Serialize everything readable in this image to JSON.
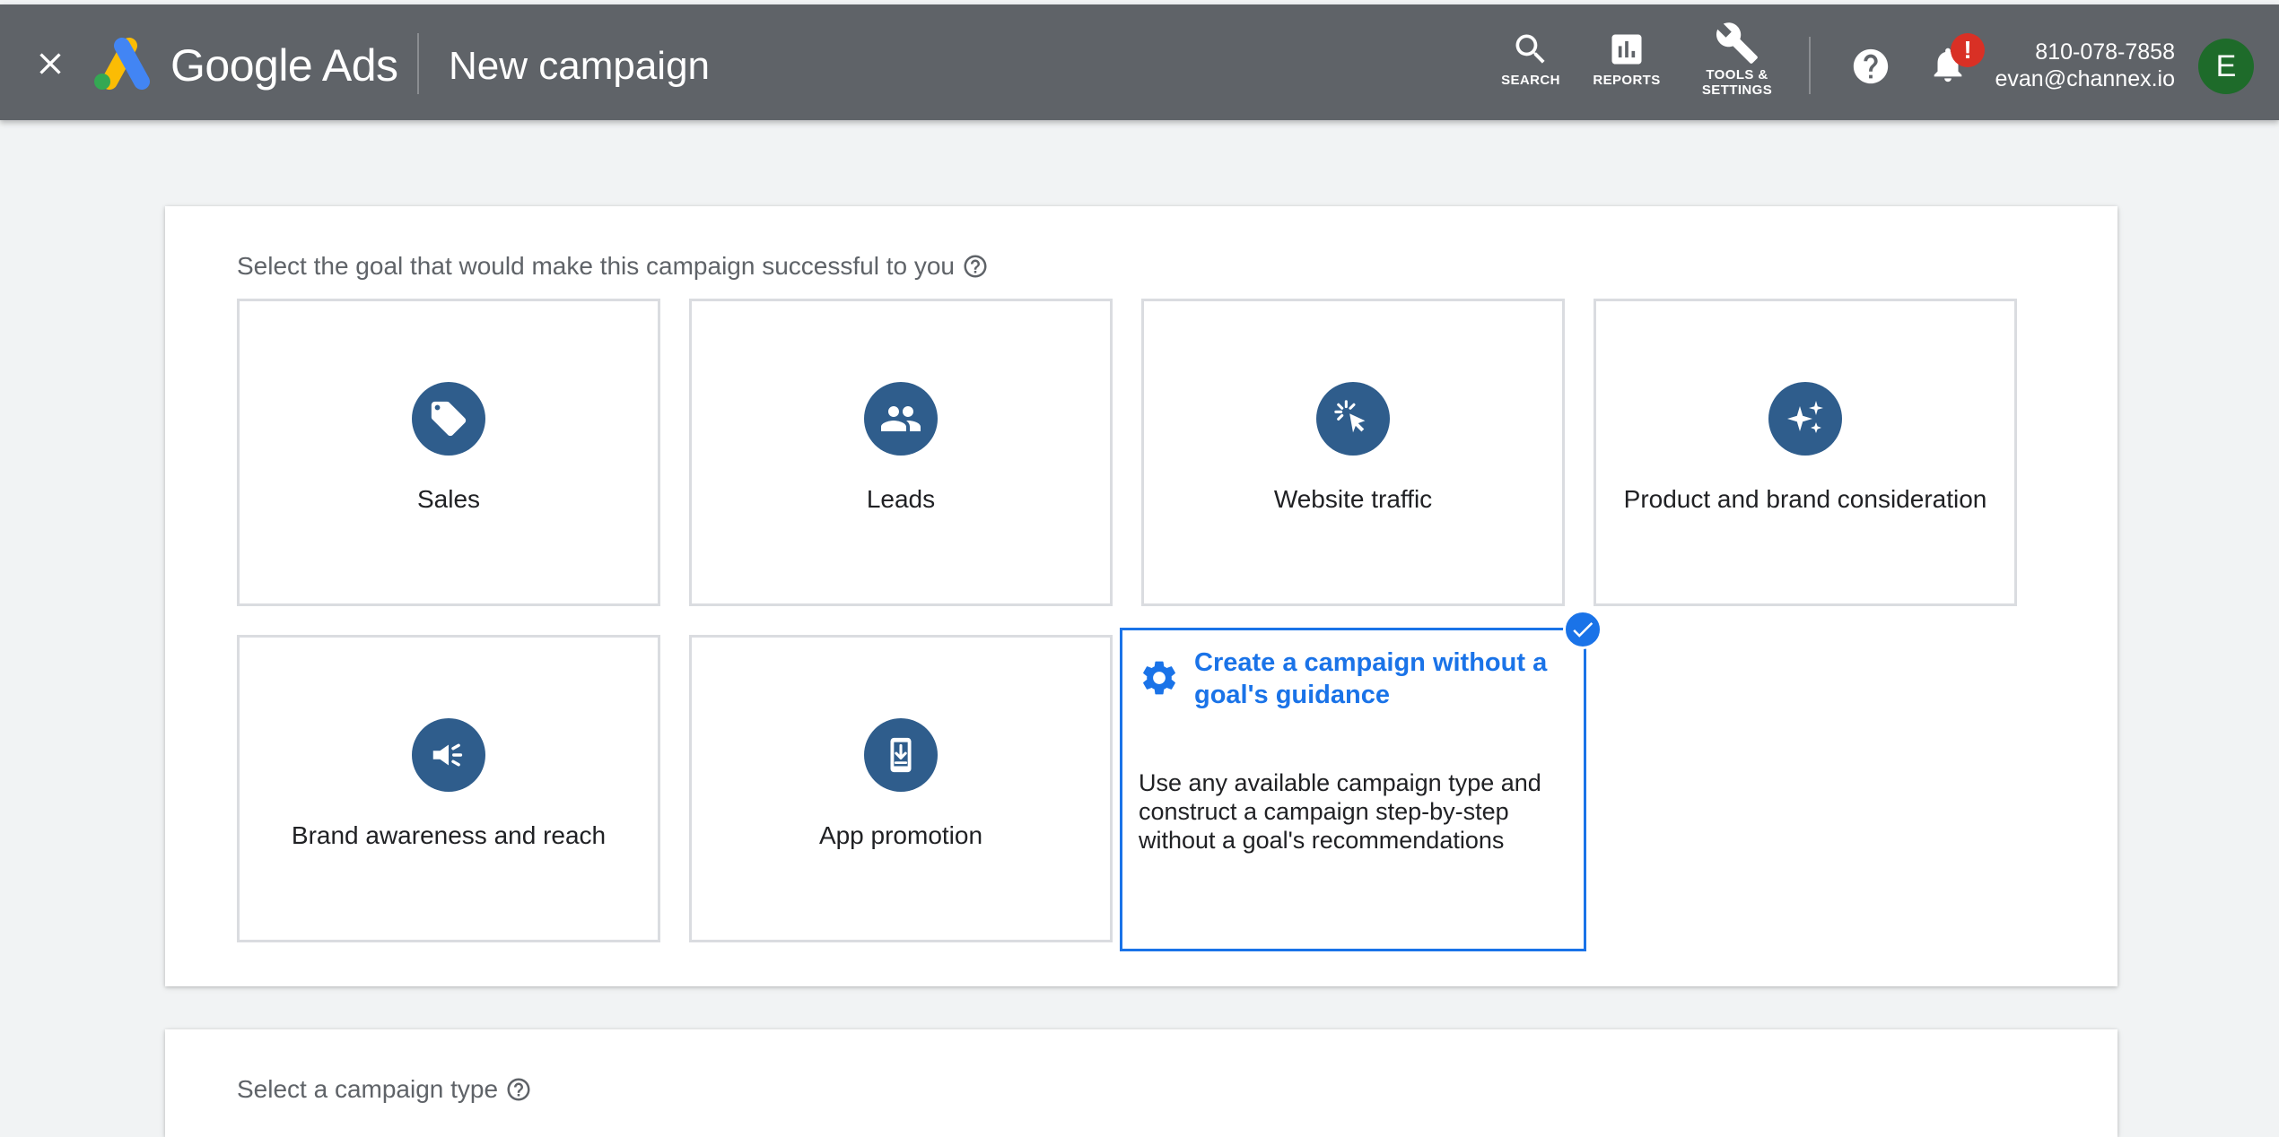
{
  "header": {
    "brand": "Google Ads",
    "title": "New campaign",
    "tools": [
      {
        "label": "SEARCH",
        "icon": "search-icon"
      },
      {
        "label": "REPORTS",
        "icon": "reports-icon"
      },
      {
        "label_line1": "TOOLS &",
        "label_line2": "SETTINGS",
        "icon": "wrench-icon"
      }
    ],
    "alert_badge": "!",
    "account": {
      "phone": "810-078-7858",
      "email": "evan@channex.io"
    },
    "avatar_initial": "E",
    "colors": {
      "bar": "#5f6368",
      "avatar": "#1e6b2a",
      "alert": "#d93025"
    }
  },
  "goal_section": {
    "heading": "Select the goal that would make this campaign successful to you",
    "goals": [
      {
        "label": "Sales",
        "icon": "tag-icon"
      },
      {
        "label": "Leads",
        "icon": "people-icon"
      },
      {
        "label": "Website traffic",
        "icon": "cursor-click-icon"
      },
      {
        "label": "Product and brand consideration",
        "icon": "sparkle-icon"
      },
      {
        "label": "Brand awareness and reach",
        "icon": "megaphone-icon"
      },
      {
        "label": "App promotion",
        "icon": "phone-download-icon"
      }
    ],
    "selected_goal": {
      "title": "Create a campaign without a goal's guidance",
      "description": "Use any available campaign type and construct a campaign step-by-step without a goal's recommendations",
      "icon": "gear-icon",
      "selected": true
    },
    "colors": {
      "icon_circle": "#2f5d8c",
      "selected_accent": "#1a73e8",
      "tile_border": "#dadce0"
    }
  },
  "type_section": {
    "heading": "Select a campaign type"
  }
}
